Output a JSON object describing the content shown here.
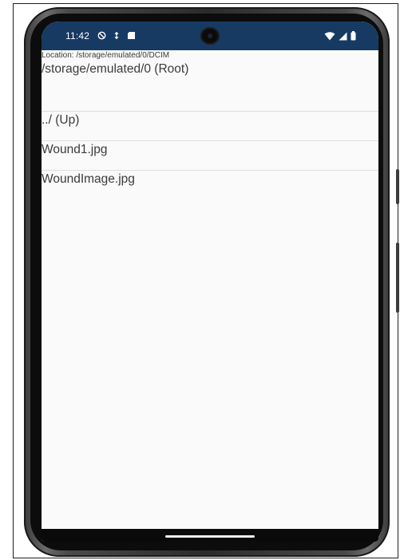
{
  "status_bar": {
    "time": "11:42",
    "icons_left": [
      "do-not-disturb-icon",
      "data-saver-icon",
      "sd-card-icon"
    ],
    "icons_right": [
      "wifi-icon",
      "signal-icon",
      "battery-icon"
    ]
  },
  "file_browser": {
    "location_label": "Location: /storage/emulated/0/DCIM",
    "entries": [
      {
        "label": "/storage/emulated/0 (Root)"
      },
      {
        "label": "../ (Up)"
      },
      {
        "label": "Wound1.jpg"
      },
      {
        "label": "WoundImage.jpg"
      }
    ]
  },
  "colors": {
    "status_bar_bg": "#173a63",
    "screen_bg": "#fafafa",
    "text": "#3b3b3b",
    "divider": "#dedede"
  }
}
